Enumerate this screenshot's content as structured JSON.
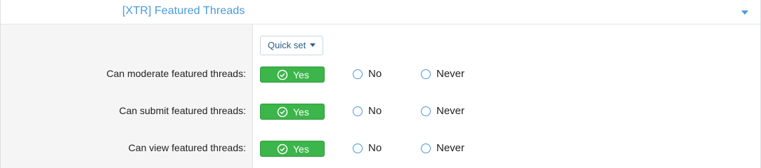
{
  "header": {
    "title": "[XTR] Featured Threads"
  },
  "quick_set": {
    "label": "Quick set"
  },
  "permissions": [
    {
      "label": "Can moderate featured threads:",
      "yes": "Yes",
      "no": "No",
      "never": "Never",
      "selected": "Yes"
    },
    {
      "label": "Can submit featured threads:",
      "yes": "Yes",
      "no": "No",
      "never": "Never",
      "selected": "Yes"
    },
    {
      "label": "Can view featured threads:",
      "yes": "Yes",
      "no": "No",
      "never": "Never",
      "selected": "Yes"
    }
  ],
  "colors": {
    "accent": "#4a9ad8",
    "yes_green": "#3cb54a"
  }
}
